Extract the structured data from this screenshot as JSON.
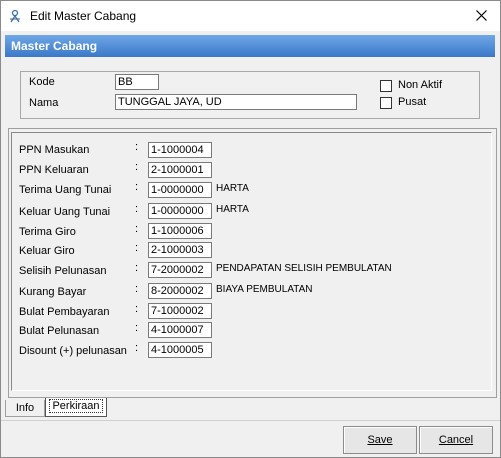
{
  "window": {
    "title": "Edit Master Cabang"
  },
  "header": {
    "title": "Master  Cabang"
  },
  "top": {
    "kode_label": "Kode",
    "kode_value": "BB",
    "nama_label": "Nama",
    "nama_value": "TUNGGAL JAYA, UD",
    "non_aktif_label": "Non Aktif",
    "pusat_label": "Pusat"
  },
  "perkiraan": {
    "rows": [
      {
        "label": "PPN Masukan",
        "code": "1-1000004",
        "desc": ""
      },
      {
        "label": "PPN Keluaran",
        "code": "2-1000001",
        "desc": ""
      },
      {
        "label": "Terima Uang Tunai",
        "code": "1-0000000",
        "desc": "HARTA"
      },
      {
        "label": "Keluar Uang Tunai",
        "code": "1-0000000",
        "desc": "HARTA"
      },
      {
        "label": "Terima Giro",
        "code": "1-1000006",
        "desc": ""
      },
      {
        "label": "Keluar Giro",
        "code": "2-1000003",
        "desc": ""
      },
      {
        "label": "Selisih Pelunasan",
        "code": "7-2000002",
        "desc": "PENDAPATAN SELISIH PEMBULATAN"
      },
      {
        "label": "Kurang Bayar",
        "code": "8-2000002",
        "desc": "BIAYA PEMBULATAN"
      },
      {
        "label": "Bulat Pembayaran",
        "code": "7-1000002",
        "desc": ""
      },
      {
        "label": "Bulat Pelunasan",
        "code": "4-1000007",
        "desc": ""
      },
      {
        "label": "Disount (+) pelunasan",
        "code": "4-1000005",
        "desc": ""
      }
    ],
    "colon": ":"
  },
  "tabs": {
    "info": "Info",
    "perkiraan": "Perkiraan"
  },
  "buttons": {
    "save": "Save",
    "cancel": "Cancel"
  }
}
